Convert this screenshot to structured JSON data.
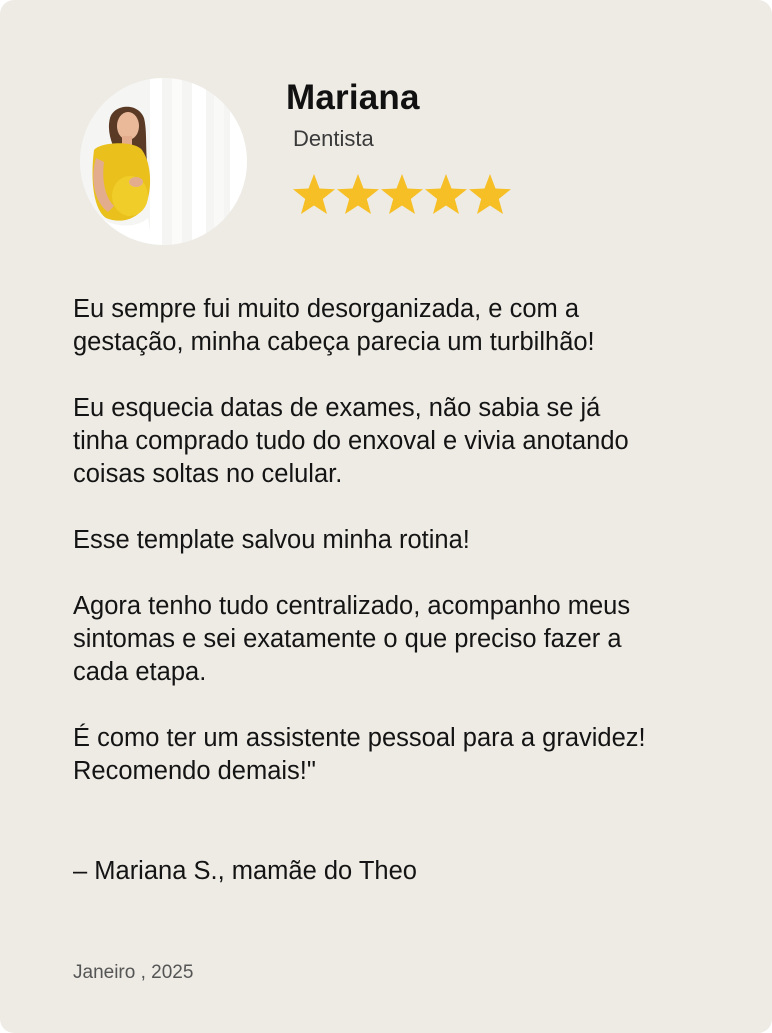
{
  "reviewer": {
    "name": "Mariana",
    "role": "Dentista",
    "rating": 5,
    "avatar_icon": "pregnant-woman-photo"
  },
  "review": {
    "paragraphs": [
      "Eu sempre fui muito desorganizada, e com a gestação, minha cabeça parecia um turbilhão!",
      "Eu esquecia datas de exames, não sabia se já tinha comprado tudo do enxoval e vivia anotando coisas soltas no celular.",
      "Esse template salvou minha rotina!",
      "Agora tenho tudo centralizado, acompanho meus sintomas e sei exatamente o que preciso fazer a cada etapa.",
      "É como ter um assistente pessoal para a gravidez! Recomendo demais!\""
    ],
    "signature": "–  Mariana S., mamãe do Theo"
  },
  "date": "Janeiro , 2025",
  "colors": {
    "card_background": "#eeebe5",
    "star": "#f6bf26",
    "text": "#141414"
  }
}
